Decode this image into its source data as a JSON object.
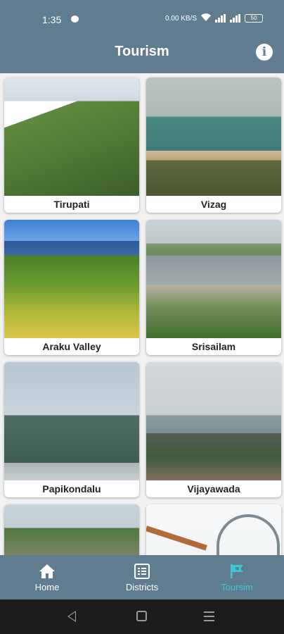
{
  "status_bar": {
    "time": "1:35",
    "network_speed": "0.00 KB/S",
    "battery": "50"
  },
  "app_bar": {
    "title": "Tourism",
    "info_icon": "info-circle-icon"
  },
  "places": [
    {
      "name": "Tirupati"
    },
    {
      "name": "Vizag"
    },
    {
      "name": "Araku Valley"
    },
    {
      "name": "Srisailam"
    },
    {
      "name": "Papikondalu"
    },
    {
      "name": "Vijayawada"
    },
    {
      "name": ""
    },
    {
      "name": ""
    }
  ],
  "bottom_nav": {
    "items": [
      {
        "label": "Home",
        "icon": "home-icon"
      },
      {
        "label": "Districts",
        "icon": "list-icon"
      },
      {
        "label": "Toursim",
        "icon": "flag-icon"
      }
    ],
    "active_color": "#3fc7d8"
  },
  "theme": {
    "primary": "#5f7d8e"
  }
}
